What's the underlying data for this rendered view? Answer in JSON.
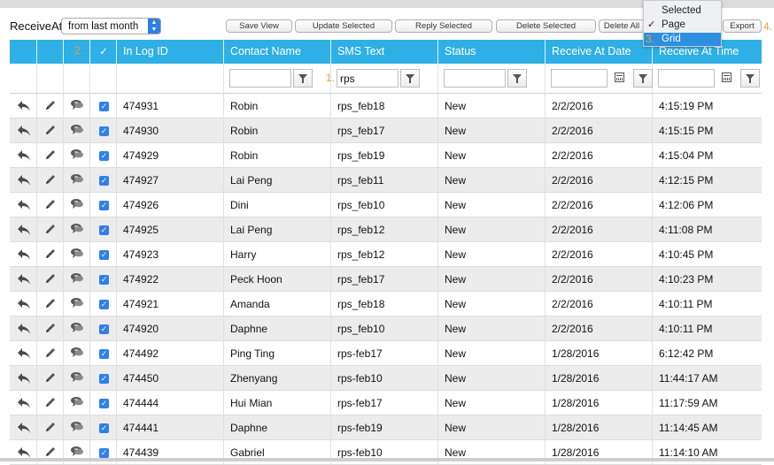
{
  "toolbar": {
    "receive_label": "ReceiveAt",
    "range_value": "from last month",
    "buttons": {
      "save_view": "Save View",
      "update_selected": "Update Selected",
      "reply_selected": "Reply Selected",
      "delete_selected": "Delete Selected",
      "delete_all": "Delete All",
      "export": "Export"
    },
    "marker_4": "4."
  },
  "export_menu": {
    "items": [
      "Selected",
      "Page",
      "Grid"
    ],
    "checked": "Page",
    "highlighted": "Grid",
    "check_mark": "✓",
    "marker_3": "3."
  },
  "grid": {
    "marker_2": "2.",
    "marker_1": "1.",
    "header_check": "✓",
    "columns": [
      "In Log ID",
      "Contact Name",
      "SMS Text",
      "Status",
      "Receive At Date",
      "Receive At Time"
    ],
    "filter": {
      "sms_text": "rps"
    },
    "rows": [
      {
        "id": "474931",
        "name": "Robin",
        "text": "rps_feb18",
        "status": "New",
        "date": "2/2/2016",
        "time": "4:15:19 PM"
      },
      {
        "id": "474930",
        "name": "Robin",
        "text": "rps_feb17",
        "status": "New",
        "date": "2/2/2016",
        "time": "4:15:15 PM"
      },
      {
        "id": "474929",
        "name": "Robin",
        "text": "rps_feb19",
        "status": "New",
        "date": "2/2/2016",
        "time": "4:15:04 PM"
      },
      {
        "id": "474927",
        "name": "Lai Peng",
        "text": "rps_feb11",
        "status": "New",
        "date": "2/2/2016",
        "time": "4:12:15 PM"
      },
      {
        "id": "474926",
        "name": "Dini",
        "text": "rps_feb10",
        "status": "New",
        "date": "2/2/2016",
        "time": "4:12:06 PM"
      },
      {
        "id": "474925",
        "name": "Lai Peng",
        "text": "rps_feb12",
        "status": "New",
        "date": "2/2/2016",
        "time": "4:11:08 PM"
      },
      {
        "id": "474923",
        "name": "Harry",
        "text": "rps_feb12",
        "status": "New",
        "date": "2/2/2016",
        "time": "4:10:45 PM"
      },
      {
        "id": "474922",
        "name": "Peck Hoon",
        "text": "rps_feb17",
        "status": "New",
        "date": "2/2/2016",
        "time": "4:10:23 PM"
      },
      {
        "id": "474921",
        "name": "Amanda",
        "text": "rps_feb18",
        "status": "New",
        "date": "2/2/2016",
        "time": "4:10:11 PM"
      },
      {
        "id": "474920",
        "name": "Daphne",
        "text": "rps_feb10",
        "status": "New",
        "date": "2/2/2016",
        "time": "4:10:11 PM"
      },
      {
        "id": "474492",
        "name": "Ping Ting",
        "text": "rps-feb17",
        "status": "New",
        "date": "1/28/2016",
        "time": "6:12:42 PM"
      },
      {
        "id": "474450",
        "name": "Zhenyang",
        "text": "rps-feb10",
        "status": "New",
        "date": "1/28/2016",
        "time": "11:44:17 AM"
      },
      {
        "id": "474444",
        "name": "Hui Mian",
        "text": "rps-feb17",
        "status": "New",
        "date": "1/28/2016",
        "time": "11:17:59 AM"
      },
      {
        "id": "474441",
        "name": "Daphne",
        "text": "rps-feb19",
        "status": "New",
        "date": "1/28/2016",
        "time": "11:14:45 AM"
      },
      {
        "id": "474439",
        "name": "Gabriel",
        "text": "rps-feb10",
        "status": "New",
        "date": "1/28/2016",
        "time": "11:14:10 AM"
      }
    ]
  },
  "icons": {
    "reply": "reply-icon",
    "edit": "pencil-icon",
    "message": "chat-bubble-icon",
    "filter": "funnel-icon",
    "calendar": "calendar-icon",
    "dropdown": "updown-arrows-icon"
  }
}
